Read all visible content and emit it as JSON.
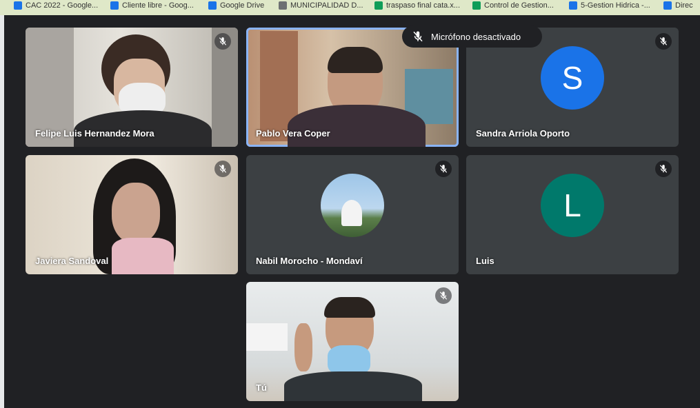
{
  "bookmarks": [
    {
      "label": "CAC 2022 - Google...",
      "color": "#1a73e8"
    },
    {
      "label": "Cliente libre - Goog...",
      "color": "#1a73e8"
    },
    {
      "label": "Google Drive",
      "color": "#1a73e8"
    },
    {
      "label": "MUNICIPALIDAD D...",
      "color": "#6d7072"
    },
    {
      "label": "traspaso final cata.x...",
      "color": "#0f9d58"
    },
    {
      "label": "Control de Gestion...",
      "color": "#0f9d58"
    },
    {
      "label": "5-Gestion Hidrica -...",
      "color": "#1a73e8"
    },
    {
      "label": "Direc",
      "color": "#1a73e8"
    }
  ],
  "notification": {
    "icon": "mic-off-icon",
    "text": "Micrófono desactivado"
  },
  "participants": [
    {
      "name": "Felipe Luis Hernandez Mora",
      "type": "video",
      "muted": true
    },
    {
      "name": "Pablo Vera Coper",
      "type": "video",
      "speaking": true
    },
    {
      "name": "Sandra Arriola Oporto",
      "type": "avatar",
      "initial": "S",
      "color": "#1a73e8",
      "muted": true
    },
    {
      "name": "Javiera Sandoval",
      "type": "video",
      "muted": true
    },
    {
      "name": "Nabil Morocho - Mondaví",
      "type": "photo",
      "muted": true
    },
    {
      "name": "Luis",
      "type": "avatar",
      "initial": "L",
      "color": "#00796b",
      "muted": true
    },
    {
      "name": "Tú",
      "type": "video",
      "muted": true
    }
  ],
  "colors": {
    "background": "#202124",
    "tile": "#3c4043",
    "speaking_border": "#8ab4f8"
  }
}
